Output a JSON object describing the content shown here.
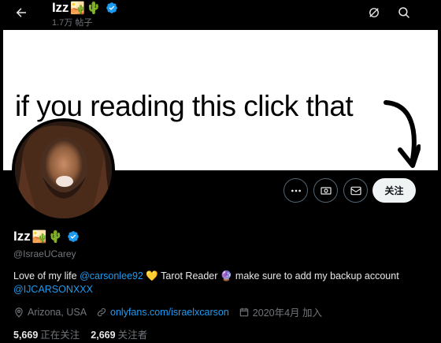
{
  "header": {
    "name": "Izz",
    "emojis": [
      "🏜️",
      "🌵"
    ],
    "post_count": "1.7万 帖子"
  },
  "banner": {
    "text": "if you reading this click that"
  },
  "actions": {
    "follow_label": "关注"
  },
  "profile": {
    "name": "Izz",
    "emojis": [
      "🏜️",
      "🌵"
    ],
    "handle": "@IsraeUCarey",
    "bio": {
      "part1": "Love of my life ",
      "mention1": "@carsonlee92",
      "part2": " 💛 Tarot Reader 🔮 make sure to add my backup account ",
      "mention2": "@IJCARSONXXX"
    },
    "location": "Arizona, USA",
    "website": "onlyfans.com/israelxcarson",
    "joined": "2020年4月 加入"
  },
  "stats": {
    "following_count": "5,669",
    "following_label": "正在关注",
    "followers_count": "2,669",
    "followers_label": "关注者"
  },
  "colors": {
    "accent": "#1d9bf0",
    "verified": "#1d9bf0",
    "muted": "#71767b"
  }
}
